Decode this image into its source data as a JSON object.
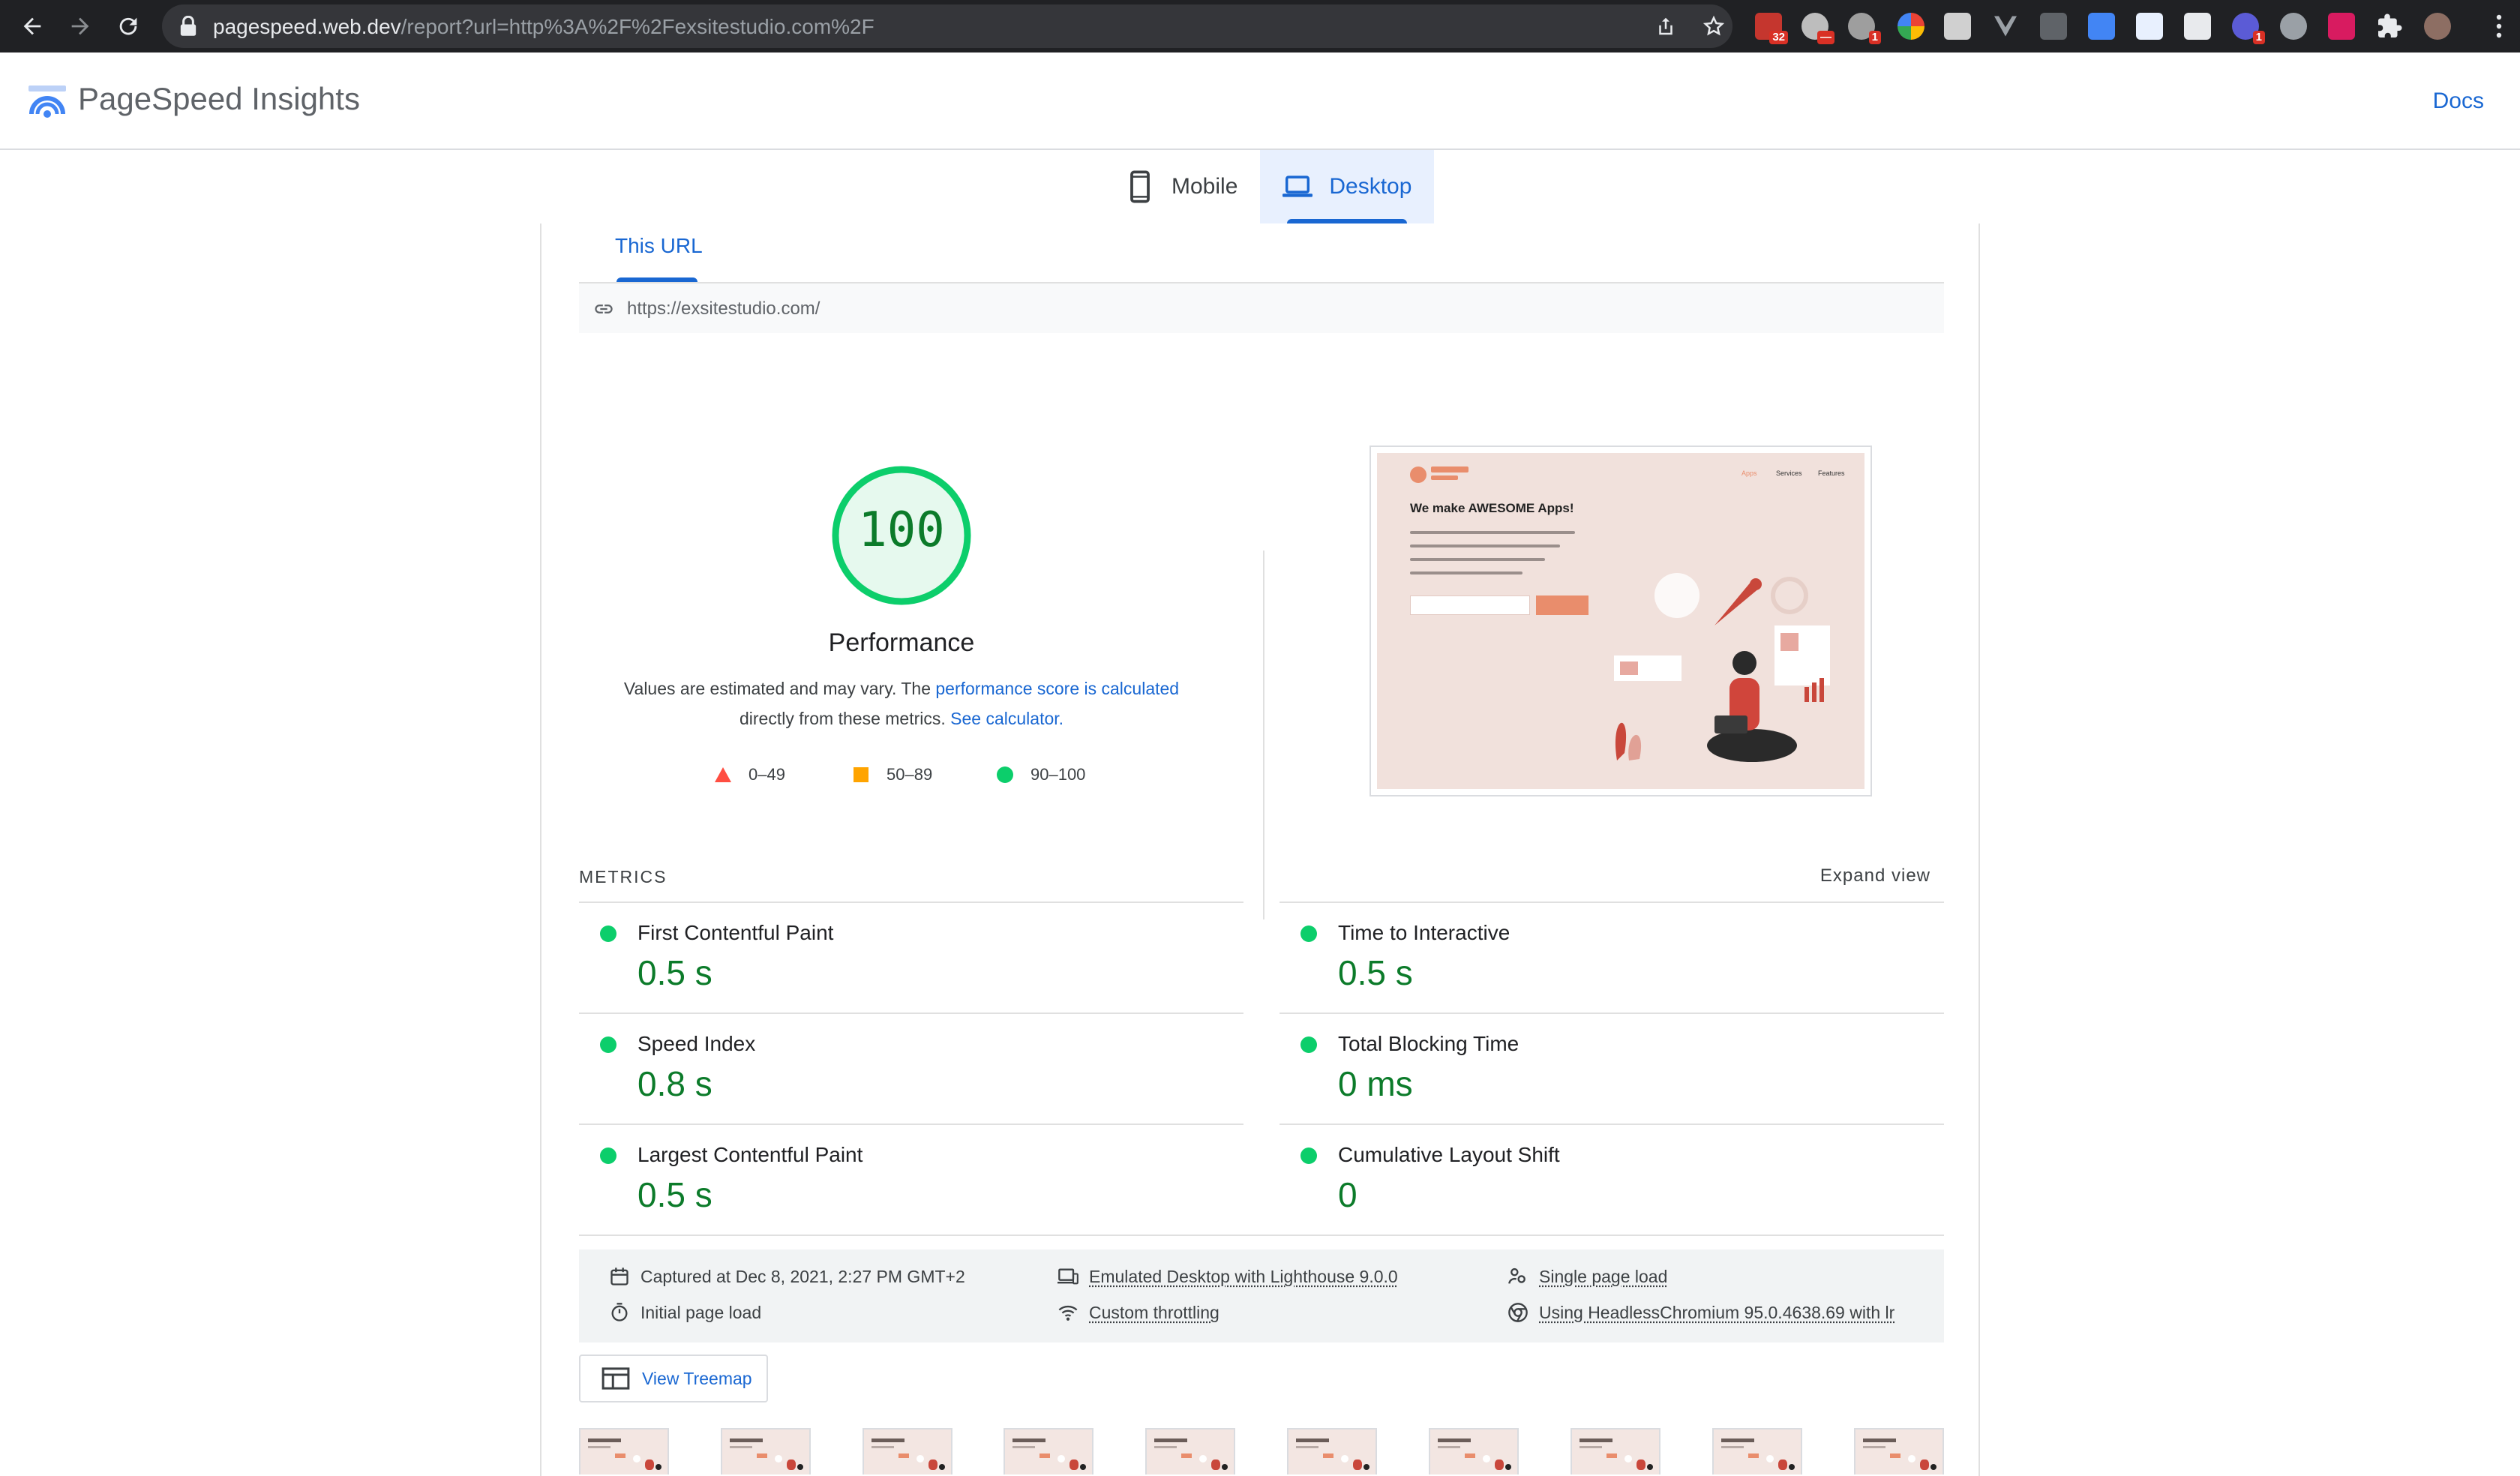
{
  "browser": {
    "url_host": "pagespeed.web.dev",
    "url_path": "/report?url=http%3A%2F%2Fexsitestudio.com%2F",
    "extension_badges": [
      "32",
      "1",
      "1"
    ]
  },
  "header": {
    "brand": "PageSpeed Insights",
    "docs_link": "Docs"
  },
  "device_tabs": [
    {
      "label": "Mobile",
      "active": false
    },
    {
      "label": "Desktop",
      "active": true
    }
  ],
  "report": {
    "url_tab": "This URL",
    "tested_url": "https://exsitestudio.com/"
  },
  "performance": {
    "score": "100",
    "score_value": 100,
    "title": "Performance",
    "desc_prefix": "Values are estimated and may vary. The",
    "desc_link1": "performance score is calculated",
    "desc_middle": "directly from these metrics.",
    "desc_link2": "See calculator.",
    "legend": [
      {
        "range": "0–49",
        "shape": "triangle",
        "color": "#ff4e42"
      },
      {
        "range": "50–89",
        "shape": "square",
        "color": "#ffa400"
      },
      {
        "range": "90–100",
        "shape": "circle",
        "color": "#0cce6b"
      }
    ]
  },
  "screenshot": {
    "headline": "We make AWESOME Apps!",
    "nav_items": [
      "Apps",
      "Services",
      "Features"
    ]
  },
  "metrics": {
    "title": "METRICS",
    "expand": "Expand view",
    "items": [
      {
        "name": "First Contentful Paint",
        "value": "0.5 s"
      },
      {
        "name": "Time to Interactive",
        "value": "0.5 s"
      },
      {
        "name": "Speed Index",
        "value": "0.8 s"
      },
      {
        "name": "Total Blocking Time",
        "value": "0 ms"
      },
      {
        "name": "Largest Contentful Paint",
        "value": "0.5 s"
      },
      {
        "name": "Cumulative Layout Shift",
        "value": "0"
      }
    ]
  },
  "run_info": {
    "captured": "Captured at Dec 8, 2021, 2:27 PM GMT+2",
    "emulated": "Emulated Desktop with Lighthouse 9.0.0",
    "load_type": "Single page load",
    "initial": "Initial page load",
    "throttling": "Custom throttling",
    "browser": "Using HeadlessChromium 95.0.4638.69 with lr"
  },
  "treemap_button": "View Treemap",
  "colors": {
    "accent": "#1967d2",
    "pass_green": "#0cce6b",
    "score_green_text": "#0c7b2a",
    "chrome_dark": "#202124"
  }
}
